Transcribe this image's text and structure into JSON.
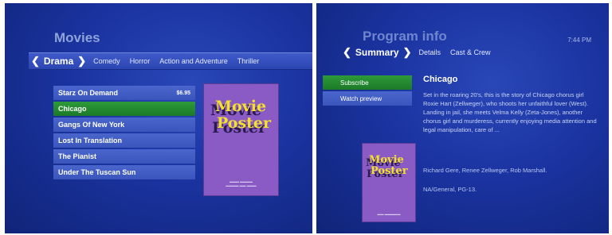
{
  "movies_screen": {
    "title": "Movies",
    "tabs": [
      {
        "label": "Drama",
        "active": true
      },
      {
        "label": "Comedy",
        "active": false
      },
      {
        "label": "Horror",
        "active": false
      },
      {
        "label": "Action and Adventure",
        "active": false
      },
      {
        "label": "Thriller",
        "active": false
      }
    ],
    "list": [
      {
        "title": "Starz On Demand",
        "price": "$6.95",
        "selected": false
      },
      {
        "title": "Chicago",
        "price": "",
        "selected": true
      },
      {
        "title": "Gangs Of New York",
        "price": "",
        "selected": false
      },
      {
        "title": "Lost In Translation",
        "price": "",
        "selected": false
      },
      {
        "title": "The Pianist",
        "price": "",
        "selected": false
      },
      {
        "title": "Under The Tuscan Sun",
        "price": "",
        "selected": false
      }
    ],
    "poster": {
      "line1": "Movie",
      "line2": "Poster"
    }
  },
  "program_info_screen": {
    "title": "Program info",
    "time": "7:44 PM",
    "tabs": [
      {
        "label": "Summary",
        "active": true
      },
      {
        "label": "Details",
        "active": false
      },
      {
        "label": "Cast & Crew",
        "active": false
      }
    ],
    "actions": {
      "subscribe": "Subscribe",
      "watch_preview": "Watch preview"
    },
    "movie_title": "Chicago",
    "description": "Set in the roaring 20's, this is the story of Chicago chorus girl Roxie Hart (Zellweger), who shoots her unfaithful lover (West). Landing in jail, she meets Velma Kelly (Zeta-Jones), another chorus girl and murderess, currently enjoying media attention and legal manipulation, care of ...",
    "cast": "Richard Gere, Renee Zellweger, Rob Marshall.",
    "rating": "NA/General, PG-13.",
    "poster": {
      "line1": "Movie",
      "line2": "Poster"
    }
  },
  "colors": {
    "background": "#1a33a0",
    "selected": "#2e9a3a",
    "item": "#4a66cc",
    "poster": "#8a5bc4",
    "poster_text": "#f5e12a"
  }
}
